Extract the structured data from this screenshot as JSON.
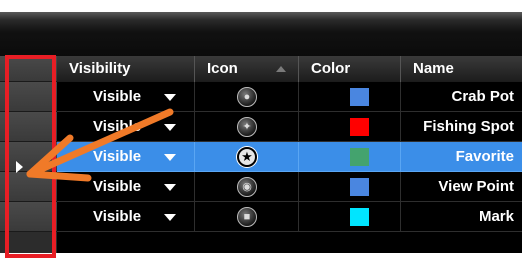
{
  "columns": {
    "visibility": "Visibility",
    "icon": "Icon",
    "color": "Color",
    "name": "Name"
  },
  "rows": [
    {
      "visibility": "Visible",
      "icon": "crab-icon",
      "color": "#4a86e0",
      "name": "Crab Pot",
      "selected": false
    },
    {
      "visibility": "Visible",
      "icon": "fish-icon",
      "color": "#ff0000",
      "name": "Fishing Spot",
      "selected": false
    },
    {
      "visibility": "Visible",
      "icon": "star-icon",
      "color": "#44a36e",
      "name": "Favorite",
      "selected": true
    },
    {
      "visibility": "Visible",
      "icon": "binoculars-icon",
      "color": "#4a86e0",
      "name": "View Point",
      "selected": false
    },
    {
      "visibility": "Visible",
      "icon": "square-mark-icon",
      "color": "#00e5ff",
      "name": "Mark",
      "selected": false
    }
  ],
  "colors": {
    "selection": "#3b8ee8",
    "annotation_box": "#e81e25",
    "annotation_arrow": "#f07a28"
  }
}
